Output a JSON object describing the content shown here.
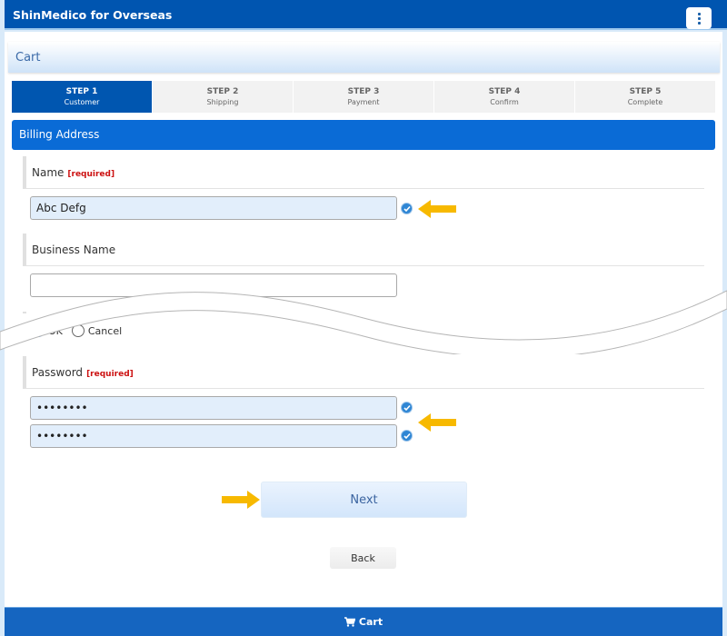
{
  "app": {
    "title": "ShinMedico for Overseas",
    "menu_icon": "kebab-menu-icon"
  },
  "page": {
    "heading": "Cart"
  },
  "steps": [
    {
      "num": "STEP 1",
      "label": "Customer",
      "active": true
    },
    {
      "num": "STEP 2",
      "label": "Shipping",
      "active": false
    },
    {
      "num": "STEP 3",
      "label": "Payment",
      "active": false
    },
    {
      "num": "STEP 4",
      "label": "Confirm",
      "active": false
    },
    {
      "num": "STEP 5",
      "label": "Complete",
      "active": false
    }
  ],
  "section": {
    "title": "Billing Address"
  },
  "fields": {
    "name": {
      "label": "Name",
      "required_tag": "[required]",
      "value": "Abc Defg",
      "valid": true
    },
    "business_name": {
      "label": "Business Name",
      "value": "",
      "placeholder": ""
    },
    "newsletter": {
      "options": [
        "OK",
        "Cancel"
      ],
      "selected": "OK"
    },
    "password": {
      "label": "Password",
      "required_tag": "[required]",
      "value": "••••••••",
      "confirm_value": "••••••••",
      "valid": true
    }
  },
  "buttons": {
    "next": "Next",
    "back": "Back"
  },
  "footer": {
    "cart_label": "Cart",
    "icon": "shopping-cart-icon"
  },
  "colors": {
    "brand": "#0055b0",
    "accent": "#0a6bd6",
    "required": "#cc1111",
    "annotation_arrow": "#f7b900"
  }
}
